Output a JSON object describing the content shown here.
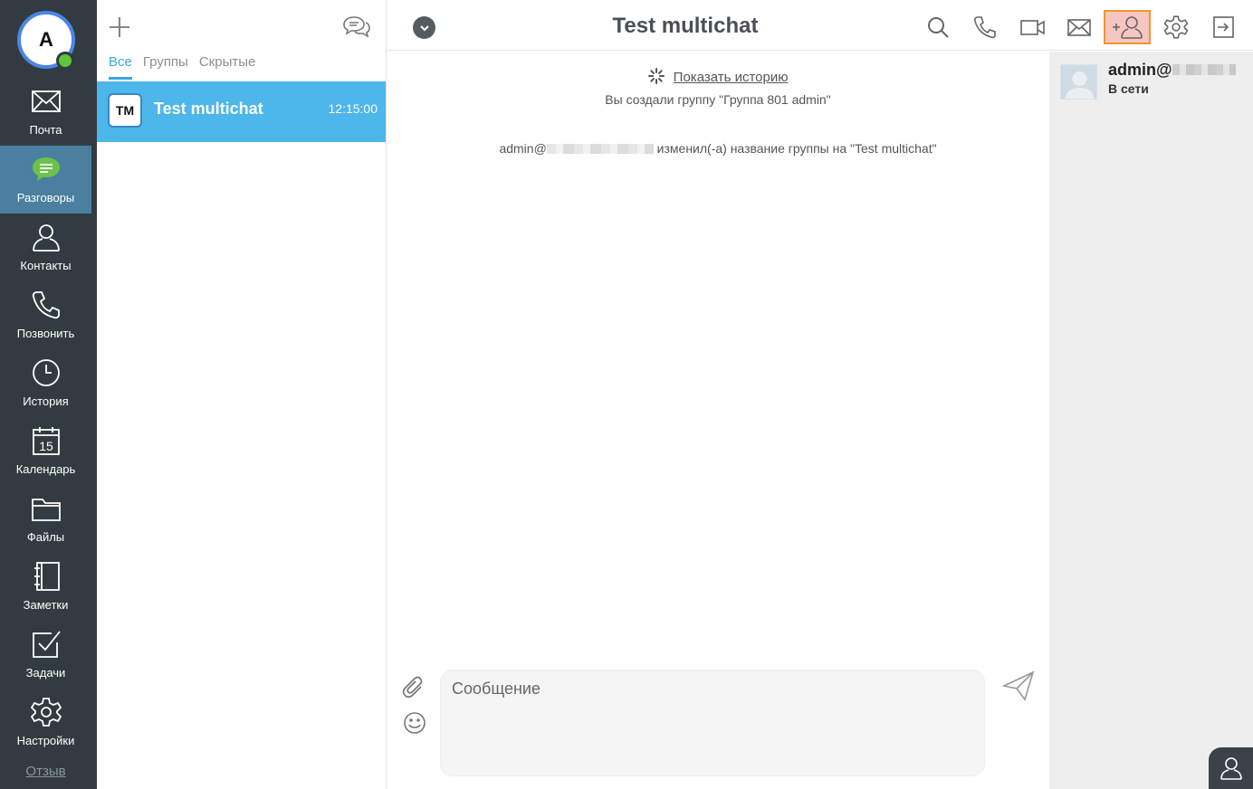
{
  "nav": {
    "avatar_letter": "A",
    "items": [
      {
        "label": "Почта",
        "icon": "mail-icon"
      },
      {
        "label": "Разговоры",
        "icon": "chat-bubble-icon"
      },
      {
        "label": "Контакты",
        "icon": "person-icon"
      },
      {
        "label": "Позвонить",
        "icon": "phone-icon"
      },
      {
        "label": "История",
        "icon": "clock-icon"
      },
      {
        "label": "Календарь",
        "icon": "calendar-icon",
        "day": "15"
      },
      {
        "label": "Файлы",
        "icon": "folder-icon"
      },
      {
        "label": "Заметки",
        "icon": "notebook-icon"
      },
      {
        "label": "Задачи",
        "icon": "checkbox-icon"
      },
      {
        "label": "Настройки",
        "icon": "gear-icon"
      }
    ],
    "logout_label": "Отзыв"
  },
  "list": {
    "tabs": [
      "Все",
      "Группы",
      "Скрытые"
    ],
    "conversation": {
      "badge": "TM",
      "title": "Test multichat",
      "time": "12:15:00"
    }
  },
  "header": {
    "title": "Test multichat"
  },
  "messages": {
    "history_link": "Показать историю",
    "system_1": "Вы создали группу \"Группа 801 admin\"",
    "system_2_prefix": "admin@",
    "system_2_suffix": " изменил(-а) название группы на \"Test multichat\""
  },
  "composer": {
    "placeholder": "Сообщение"
  },
  "members": {
    "name_prefix": "admin@",
    "status": "В сети"
  },
  "colors": {
    "nav_bg": "#323b41",
    "nav_active": "#4a7f9f",
    "accent": "#4db6ea",
    "tab_active": "#3aa7e0",
    "online": "#5cc83a",
    "highlight_bg": "#f7c6c0",
    "highlight_border": "#f0962e"
  }
}
